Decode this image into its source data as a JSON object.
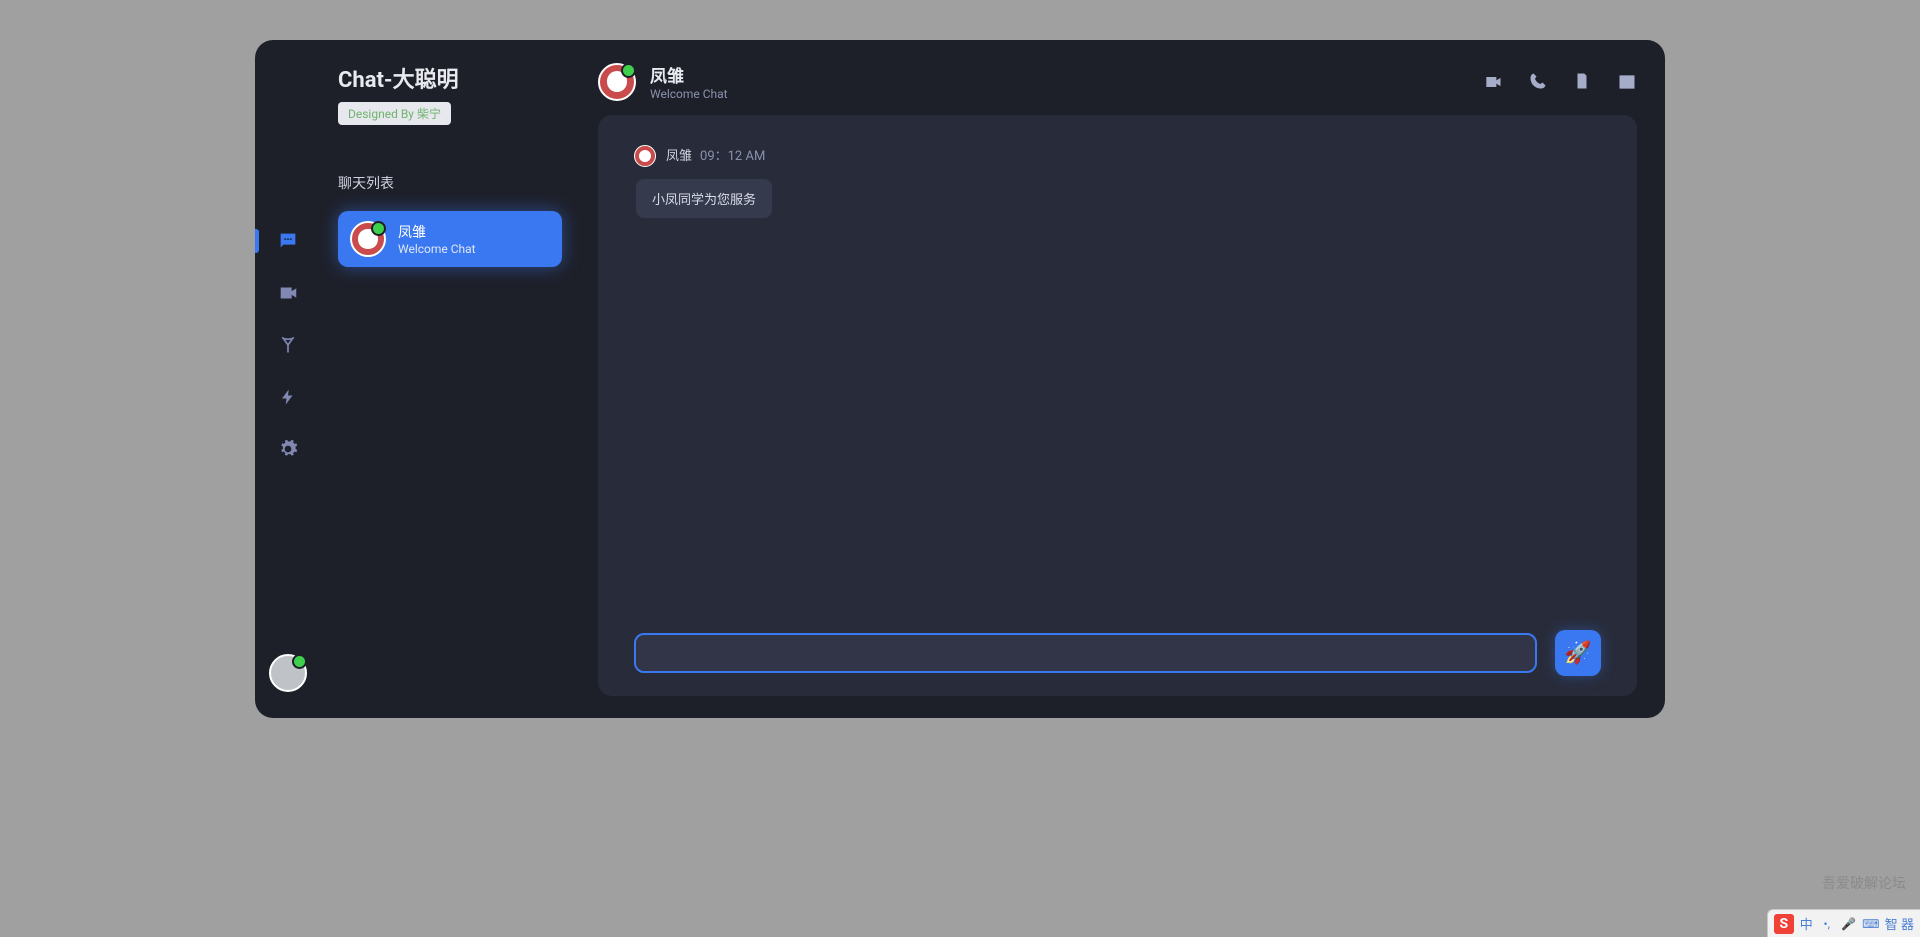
{
  "app": {
    "title": "Chat-大聪明",
    "designed_by": "Designed By 柴宁"
  },
  "sidebar": {
    "section_label": "聊天列表",
    "items": [
      {
        "name": "凤雏",
        "subtitle": "Welcome Chat"
      }
    ]
  },
  "header": {
    "name": "凤雏",
    "subtitle": "Welcome Chat"
  },
  "messages": [
    {
      "author": "凤雏",
      "time": "09：12 AM",
      "text": "小凤同学为您服务"
    }
  ],
  "input": {
    "value": "",
    "send_icon": "🚀"
  },
  "watermark": "吾爱破解论坛",
  "ime": {
    "logo": "S",
    "lang": "中",
    "extra": "智 器"
  }
}
